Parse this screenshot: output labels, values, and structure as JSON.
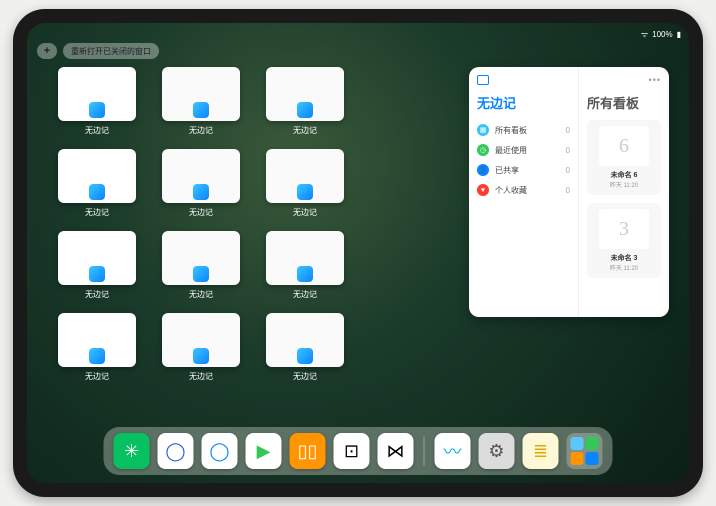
{
  "status": {
    "time": "",
    "battery": "100%"
  },
  "topbar": {
    "plus": "+",
    "reopen_label": "重新打开已关闭的窗口"
  },
  "thumbnails": {
    "label": "无边记",
    "items": [
      {
        "type": "blank"
      },
      {
        "type": "cal"
      },
      {
        "type": "cal"
      },
      {
        "type": "blank"
      },
      {
        "type": "cal"
      },
      {
        "type": "cal"
      },
      {
        "type": "blank"
      },
      {
        "type": "cal"
      },
      {
        "type": "cal"
      },
      {
        "type": "blank"
      },
      {
        "type": "cal"
      },
      {
        "type": "cal"
      }
    ]
  },
  "panel": {
    "left_title": "无边记",
    "right_title": "所有看板",
    "menu": [
      {
        "icon": "grid",
        "color": "#34c7f5",
        "label": "所有看板",
        "count": "0"
      },
      {
        "icon": "clock",
        "color": "#34c759",
        "label": "最近使用",
        "count": "0"
      },
      {
        "icon": "person",
        "color": "#0a84ff",
        "label": "已共享",
        "count": "0"
      },
      {
        "icon": "heart",
        "color": "#ff3b30",
        "label": "个人收藏",
        "count": "0"
      }
    ],
    "boards": [
      {
        "glyph": "6",
        "name": "未命名 6",
        "time": "昨天 11:20"
      },
      {
        "glyph": "3",
        "name": "未命名 3",
        "time": "昨天 11:20"
      }
    ]
  },
  "dock": {
    "apps": [
      {
        "name": "wechat",
        "bg": "#07c160",
        "glyph": "✳"
      },
      {
        "name": "quark",
        "bg": "#ffffff",
        "glyph": "◯",
        "fg": "#2a5bd7"
      },
      {
        "name": "browser",
        "bg": "#ffffff",
        "glyph": "◯",
        "fg": "#0a84ff"
      },
      {
        "name": "play",
        "bg": "#ffffff",
        "glyph": "▶",
        "fg": "#34c759"
      },
      {
        "name": "books",
        "bg": "#ff9500",
        "glyph": "▯▯",
        "fg": "#fff"
      },
      {
        "name": "dice",
        "bg": "#ffffff",
        "glyph": "⊡",
        "fg": "#000"
      },
      {
        "name": "connect",
        "bg": "#ffffff",
        "glyph": "⋈",
        "fg": "#000"
      }
    ],
    "recents": [
      {
        "name": "freeform",
        "bg": "#ffffff",
        "glyph": "〰",
        "fg": "#0ad"
      },
      {
        "name": "settings",
        "bg": "#dcdcdc",
        "glyph": "⚙",
        "fg": "#555"
      },
      {
        "name": "notes",
        "bg": "#fff8d6",
        "glyph": "≣",
        "fg": "#e0a800"
      }
    ],
    "folder_colors": [
      "#5ac8fa",
      "#34c759",
      "#ff9500",
      "#0a84ff"
    ]
  }
}
